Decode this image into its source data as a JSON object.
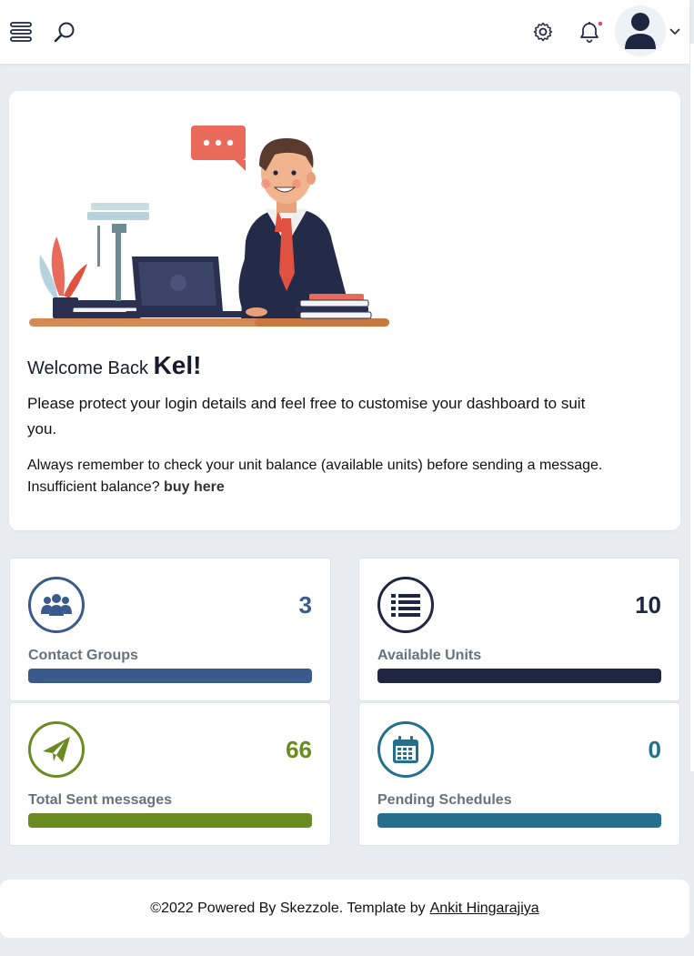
{
  "header": {
    "menu_icon": "hamburger-icon",
    "search_icon": "search-icon",
    "settings_icon": "gear-icon",
    "notifications_icon": "bell-icon",
    "notification_dot_color": "#e0457b",
    "avatar_icon": "user-icon",
    "dropdown_icon": "chevron-down-icon"
  },
  "welcome": {
    "greeting": "Welcome Back",
    "name": "Kel!",
    "message": "Please protect your login details and feel free to customise your dashboard to suit you.",
    "reminder": "Always remember to check your unit balance (available units) before sending a message. Insufficient balance?",
    "buy_link": "buy here"
  },
  "stats": [
    {
      "label": "Contact Groups",
      "value": "3",
      "icon": "users-icon",
      "color": "#3a5a8c"
    },
    {
      "label": "Available Units",
      "value": "10",
      "icon": "list-icon",
      "color": "#1e2642"
    },
    {
      "label": "Total Sent messages",
      "value": "66",
      "icon": "paper-plane-icon",
      "color": "#6a8b22"
    },
    {
      "label": "Pending Schedules",
      "value": "0",
      "icon": "calendar-icon",
      "color": "#256f8e"
    }
  ],
  "footer": {
    "text": "©2022 Powered By Skezzole. Template by",
    "link": "Ankit Hingarajiya"
  }
}
